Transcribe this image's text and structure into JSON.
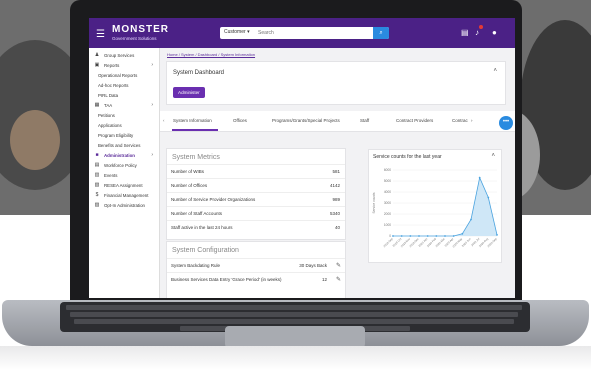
{
  "app": {
    "logo": "MONSTER",
    "logo_sub": "Government Solutions",
    "search": {
      "filter": "Customer",
      "placeholder": "Search"
    }
  },
  "sidebar": {
    "items": [
      {
        "label": "Group Services",
        "icon": "group-icon"
      },
      {
        "label": "Reports",
        "icon": "report-icon",
        "arrow": "›"
      },
      {
        "label": "Operational Reports",
        "sub": true
      },
      {
        "label": "Ad-hoc Reports",
        "sub": true
      },
      {
        "label": "PIRL Data",
        "sub": true
      },
      {
        "label": "TAA",
        "icon": "taa-icon",
        "arrow": "›"
      },
      {
        "label": "Petitions",
        "sub": true
      },
      {
        "label": "Applications",
        "sub": true
      },
      {
        "label": "Program Eligibility",
        "sub": true
      },
      {
        "label": "Benefits and Services",
        "sub": true
      },
      {
        "label": "Administration",
        "icon": "admin-icon",
        "arrow": "›",
        "active": true
      },
      {
        "label": "Workforce Policy",
        "icon": "policy-icon"
      },
      {
        "label": "Events",
        "icon": "events-icon"
      },
      {
        "label": "RESEA Assignment",
        "icon": "resea-icon"
      },
      {
        "label": "Financial Management",
        "icon": "dollar-icon"
      },
      {
        "label": "Opt-In Administration",
        "icon": "optin-icon"
      }
    ]
  },
  "main": {
    "breadcrumb": "Home / System / Dashboard / System Information",
    "dashboard_title": "System Dashboard",
    "admin_button": "Administer",
    "tabs": [
      "System Information",
      "Offices",
      "Programs/Grants/Special Projects",
      "Staff",
      "Contract Providers",
      "Contrac"
    ],
    "metrics": {
      "title": "System Metrics",
      "rows": [
        {
          "label": "Number of WIBs",
          "value": "581"
        },
        {
          "label": "Number of Offices",
          "value": "4142"
        },
        {
          "label": "Number of Service Provider Organizations",
          "value": "989"
        },
        {
          "label": "Number of Staff Accounts",
          "value": "5340"
        },
        {
          "label": "Staff active in the last 24 hours",
          "value": "40"
        }
      ]
    },
    "config": {
      "title": "System Configuration",
      "rows": [
        {
          "label": "System Backdating Rule",
          "value": "30 Days Back"
        },
        {
          "label": "Business Services Data Entry 'Grace Period' (in weeks)",
          "value": "12"
        }
      ]
    }
  },
  "chart_data": {
    "type": "area",
    "title": "Service counts for the last year",
    "ylabel": "Service counts",
    "ylim": [
      0,
      6000
    ],
    "yticks": [
      "0",
      "1000",
      "2000",
      "3000",
      "4000",
      "5000",
      "6000"
    ],
    "categories": [
      "2019 Sep",
      "2019 Oct",
      "2019 Nov",
      "2019 Dec",
      "2020 Jan",
      "2020 Feb",
      "2020 Mar",
      "2020 Apr",
      "2020 May",
      "2020 Jun",
      "2020 Jul",
      "2020 Aug",
      "2020 Sep"
    ],
    "values": [
      0,
      0,
      0,
      0,
      0,
      0,
      0,
      0,
      200,
      1500,
      5300,
      3500,
      100
    ],
    "color": "#4aa3df"
  }
}
